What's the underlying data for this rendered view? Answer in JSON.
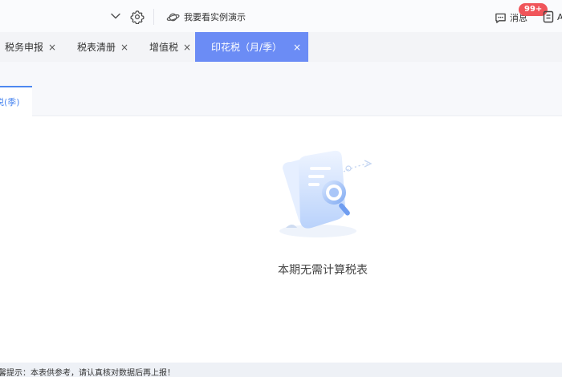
{
  "header": {
    "demo_label": "我要看实例演示",
    "messages_label": "消息",
    "messages_badge": "99+",
    "account_label": "A"
  },
  "tabs": [
    {
      "label": "税务申报",
      "close": "×"
    },
    {
      "label": "税表清册",
      "close": "×"
    },
    {
      "label": "增值税",
      "close": "×"
    },
    {
      "label": "印花税（月/季）",
      "close": "×"
    }
  ],
  "subtab": {
    "label": "税(季)"
  },
  "empty_state": {
    "message": "本期无需计算税表"
  },
  "footer": {
    "notice": "温馨提示：本表供参考，请认真核对数据后再上报！"
  },
  "colors": {
    "accent": "#6b8cf5",
    "badge": "#f0555a",
    "link": "#4d88f0"
  }
}
